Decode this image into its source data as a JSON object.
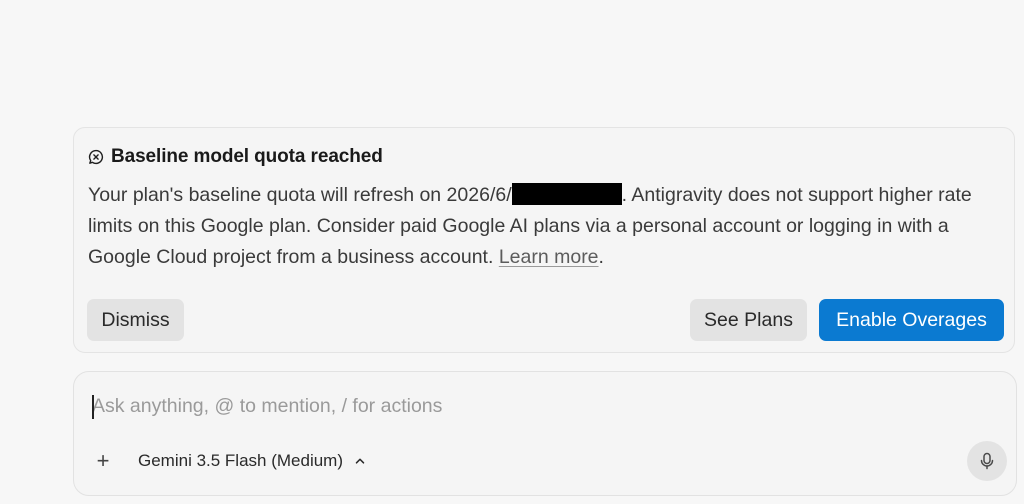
{
  "notice": {
    "title": "Baseline model quota reached",
    "body_before_redaction": "Your plan's baseline quota will refresh on 2026/6/",
    "body_after_redaction": ". Antigravity does not support higher rate limits on this Google plan. Consider paid Google AI plans via a personal account or logging in with a Google Cloud project from a business account. ",
    "learn_more_label": "Learn more",
    "body_end": ".",
    "dismiss_label": "Dismiss",
    "see_plans_label": "See Plans",
    "enable_overages_label": "Enable Overages",
    "icons": {
      "title_icon": "message-x-icon"
    },
    "colors": {
      "primary_button": "#0b7ad1",
      "secondary_button": "#e3e3e3"
    }
  },
  "composer": {
    "placeholder": "Ask anything, @ to mention, / for actions",
    "value": "",
    "add_label": "+",
    "model_label": "Gemini 3.5 Flash (Medium)",
    "icons": {
      "add": "plus-icon",
      "model_toggle": "chevron-up-icon",
      "voice": "microphone-icon"
    }
  }
}
